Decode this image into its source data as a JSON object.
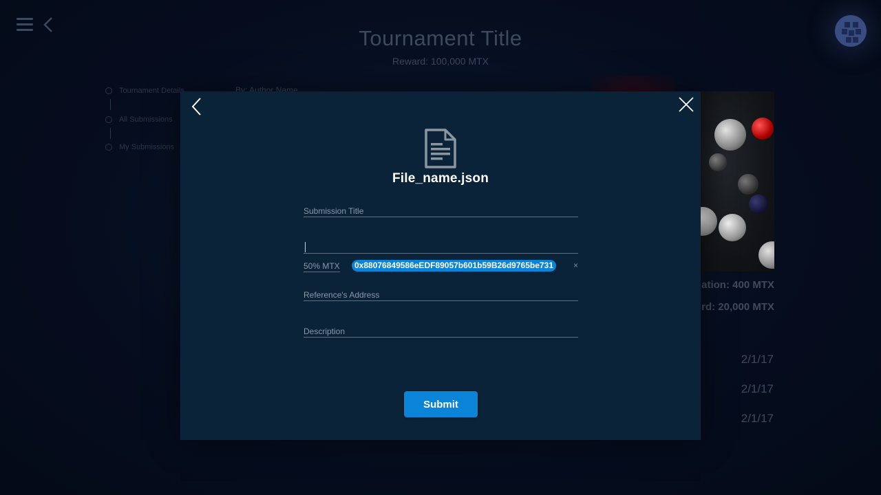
{
  "header": {
    "title": "Tournament Title",
    "reward": "Reward: 100,000 MTX"
  },
  "sidenav": {
    "items": [
      {
        "label": "Tournament Details"
      },
      {
        "label": "All Submissions"
      },
      {
        "label": "My Submissions"
      }
    ]
  },
  "tournament": {
    "author": "By: Author Name",
    "stats": [
      "ation: 400 MTX",
      "rd: 20,000 MTX"
    ],
    "dates": [
      "2/1/17",
      "2/1/17",
      "2/1/17"
    ]
  },
  "modal": {
    "file_name": "File_name.json",
    "submission_title_label": "Submission Title",
    "contributor_input_value": "",
    "percent_label": "50% MTX",
    "address_chip": "0x88076849586eEDF89057b601b59B26d9765be731",
    "chip_remove": "×",
    "reference_label": "Reference's Address",
    "description_label": "Description",
    "submit_label": "Submit"
  },
  "colors": {
    "accent": "#0a84d6",
    "modal_bg": "#0b2338",
    "page_bg": "#060d1f"
  },
  "icons": {
    "menu": "hamburger-icon",
    "back": "chevron-left-icon",
    "close": "close-icon",
    "file": "document-icon"
  }
}
